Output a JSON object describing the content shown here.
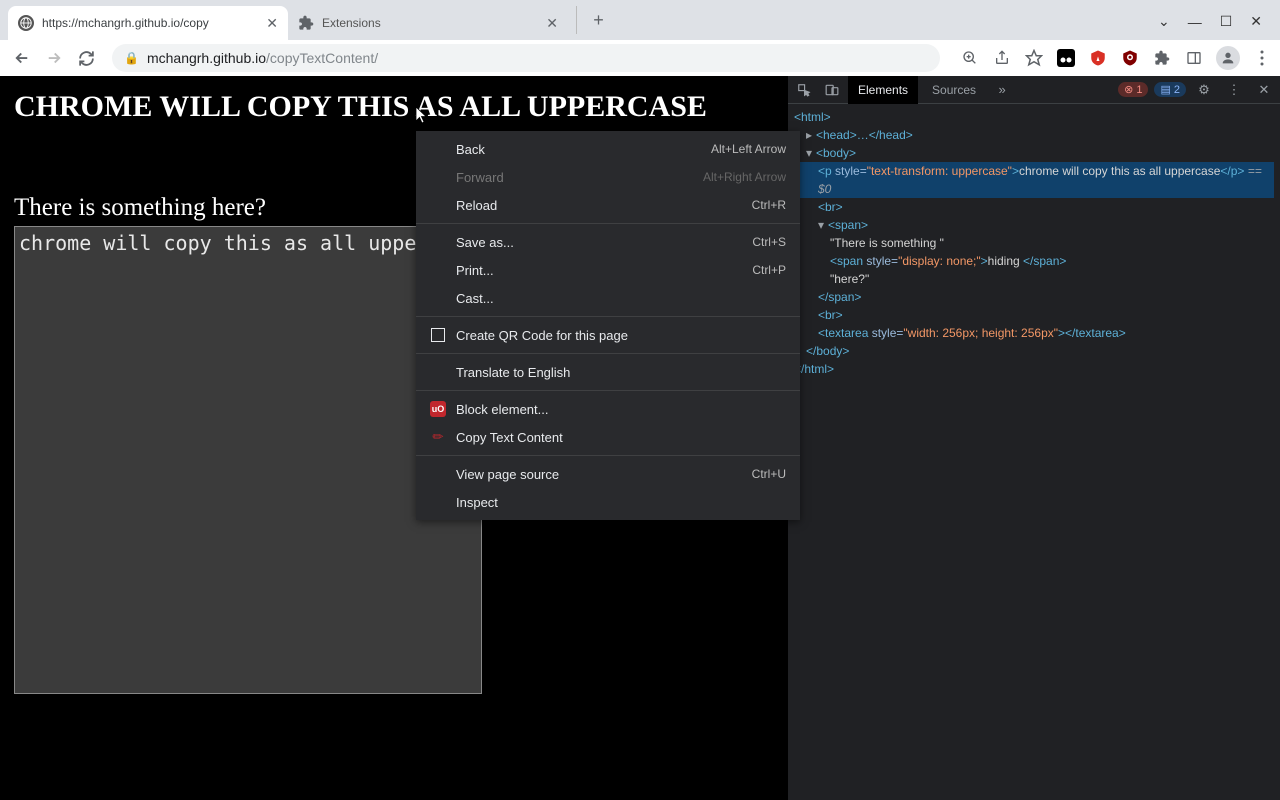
{
  "titlebar": {
    "tabs": [
      {
        "title": "https://mchangrh.github.io/copy",
        "active": true
      },
      {
        "title": "Extensions",
        "active": false
      }
    ]
  },
  "toolbar": {
    "url_host": "mchangrh.github.io",
    "url_path": "/copyTextContent/"
  },
  "page": {
    "heading": "CHROME WILL COPY THIS AS ALL UPPERCASE",
    "subheading": "There is something here?",
    "textarea_value": "chrome will copy this as all uppercase"
  },
  "contextMenu": {
    "back": {
      "label": "Back",
      "shortcut": "Alt+Left Arrow"
    },
    "forward": {
      "label": "Forward",
      "shortcut": "Alt+Right Arrow"
    },
    "reload": {
      "label": "Reload",
      "shortcut": "Ctrl+R"
    },
    "saveas": {
      "label": "Save as...",
      "shortcut": "Ctrl+S"
    },
    "print": {
      "label": "Print...",
      "shortcut": "Ctrl+P"
    },
    "cast": {
      "label": "Cast..."
    },
    "qr": {
      "label": "Create QR Code for this page"
    },
    "translate": {
      "label": "Translate to English"
    },
    "block": {
      "label": "Block element..."
    },
    "copytext": {
      "label": "Copy Text Content"
    },
    "source": {
      "label": "View page source",
      "shortcut": "Ctrl+U"
    },
    "inspect": {
      "label": "Inspect"
    }
  },
  "devtools": {
    "tabs": {
      "elements": "Elements",
      "sources": "Sources"
    },
    "badges": {
      "errors": "1",
      "messages": "2"
    },
    "dom": {
      "html_open": "<html>",
      "head": "<head>…</head>",
      "body_open": "<body>",
      "p_open_attr": "style=",
      "p_style": "\"text-transform: uppercase\"",
      "p_text": "chrome will copy this as all uppercase",
      "p_sel": " == $0",
      "br1": "<br>",
      "span_open": "<span>",
      "span_t1": "\"There is something \"",
      "span_inner_style": "\"display: none;\"",
      "span_inner_text": "hiding ",
      "span_t2": "\"here?\"",
      "span_close": "</span>",
      "br2": "<br>",
      "textarea_style": "\"width: 256px; height: 256px\"",
      "body_close": "</body>",
      "html_close": "</html>"
    }
  }
}
